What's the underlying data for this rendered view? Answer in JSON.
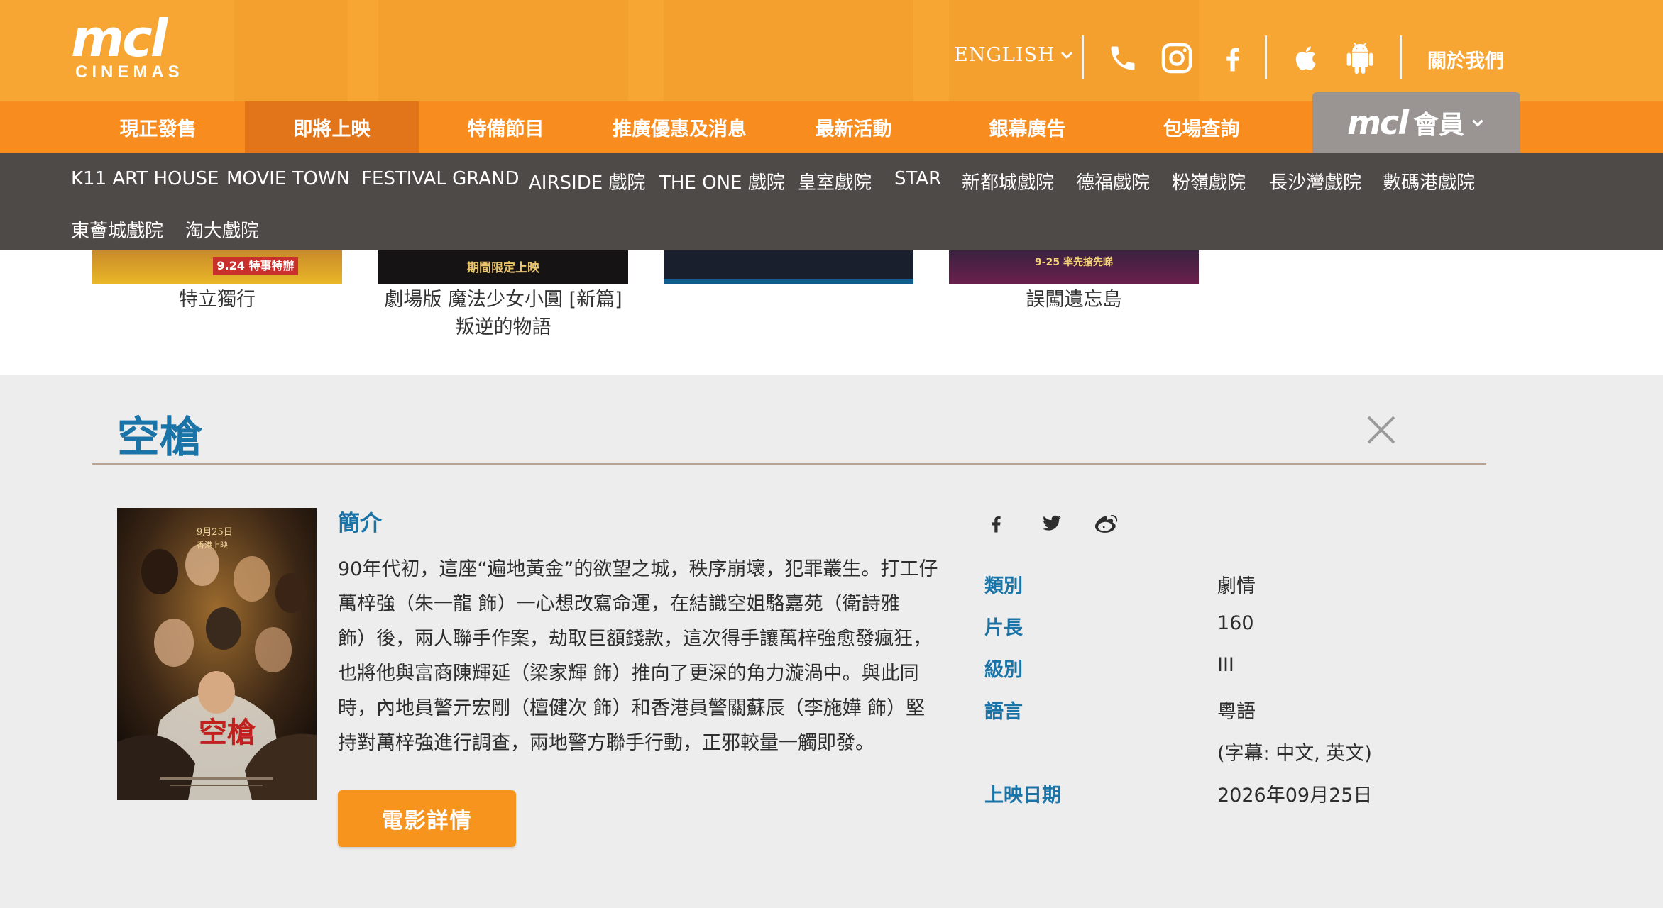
{
  "header": {
    "logo_main": "mcl",
    "logo_sub": "CINEMAS",
    "language": "ENGLISH",
    "about": "關於我們",
    "icons": [
      "phone-icon",
      "instagram-icon",
      "facebook-icon",
      "apple-icon",
      "android-icon",
      "chevron-down-icon"
    ]
  },
  "nav": {
    "items": [
      "現正發售",
      "即將上映",
      "特備節目",
      "推廣優惠及消息",
      "最新活動",
      "銀幕廣告",
      "包場查詢"
    ],
    "active": "即將上映",
    "member_logo": "mcl",
    "member_label": "會員"
  },
  "cinemas": [
    "K11 ART HOUSE",
    "MOVIE TOWN",
    "FESTIVAL GRAND",
    "AIRSIDE 戲院",
    "THE ONE 戲院",
    "皇室戲院",
    "STAR",
    "新都城戲院",
    "德福戲院",
    "粉嶺戲院",
    "長沙灣戲院",
    "數碼港戲院",
    "東薈城戲院",
    "淘大戲院"
  ],
  "strip": {
    "titles": [
      "特立獨行",
      "劇場版 魔法少女小圓 [新篇]",
      "叛逆的物語",
      "誤闖遺忘島"
    ],
    "poster_texts": [
      "9.24 特事特辦",
      "期間限定上映",
      "9-25 率先搶先睇"
    ]
  },
  "movie": {
    "title": "空槍",
    "intro_heading": "簡介",
    "synopsis_lines": [
      "90年代初，這座“遍地黃金”的欲望之城，秩序崩壞，犯罪叢生。打工仔",
      "萬梓強（朱一龍 飾）一心想改寫命運，在結識空姐駱嘉苑（衛詩雅",
      "飾）後，兩人聯手作案，劫取巨額錢款，這次得手讓萬梓強愈發瘋狂，",
      "也將他與富商陳輝延（梁家輝 飾）推向了更深的角力漩渦中。與此同",
      "時，內地員警亓宏剛（檀健次 飾）和香港員警關蘇辰（李施嬅 飾）堅",
      "持對萬梓強進行調查，兩地警方聯手行動，正邪較量一觸即發。"
    ],
    "details_button": "電影詳情",
    "poster_text": {
      "date": "9月25日",
      "place": "香港上映",
      "title": "空槍"
    },
    "share_icons": [
      "facebook-icon",
      "twitter-icon",
      "weibo-icon"
    ],
    "info": {
      "genre_label": "類別",
      "genre": "劇情",
      "duration_label": "片長",
      "duration": "160",
      "rating_label": "級別",
      "rating": "III",
      "language_label": "語言",
      "language": "粵語",
      "subtitles": "(字幕: 中文, 英文)",
      "release_label": "上映日期",
      "release": "2026年09月25日"
    }
  },
  "colors": {
    "header": "#f8a633",
    "nav": "#f98c1e",
    "nav_active": "#e2741a",
    "cinema_bar": "#4e4a47",
    "accent_blue": "#1b74a8",
    "button": "#f7941e"
  }
}
